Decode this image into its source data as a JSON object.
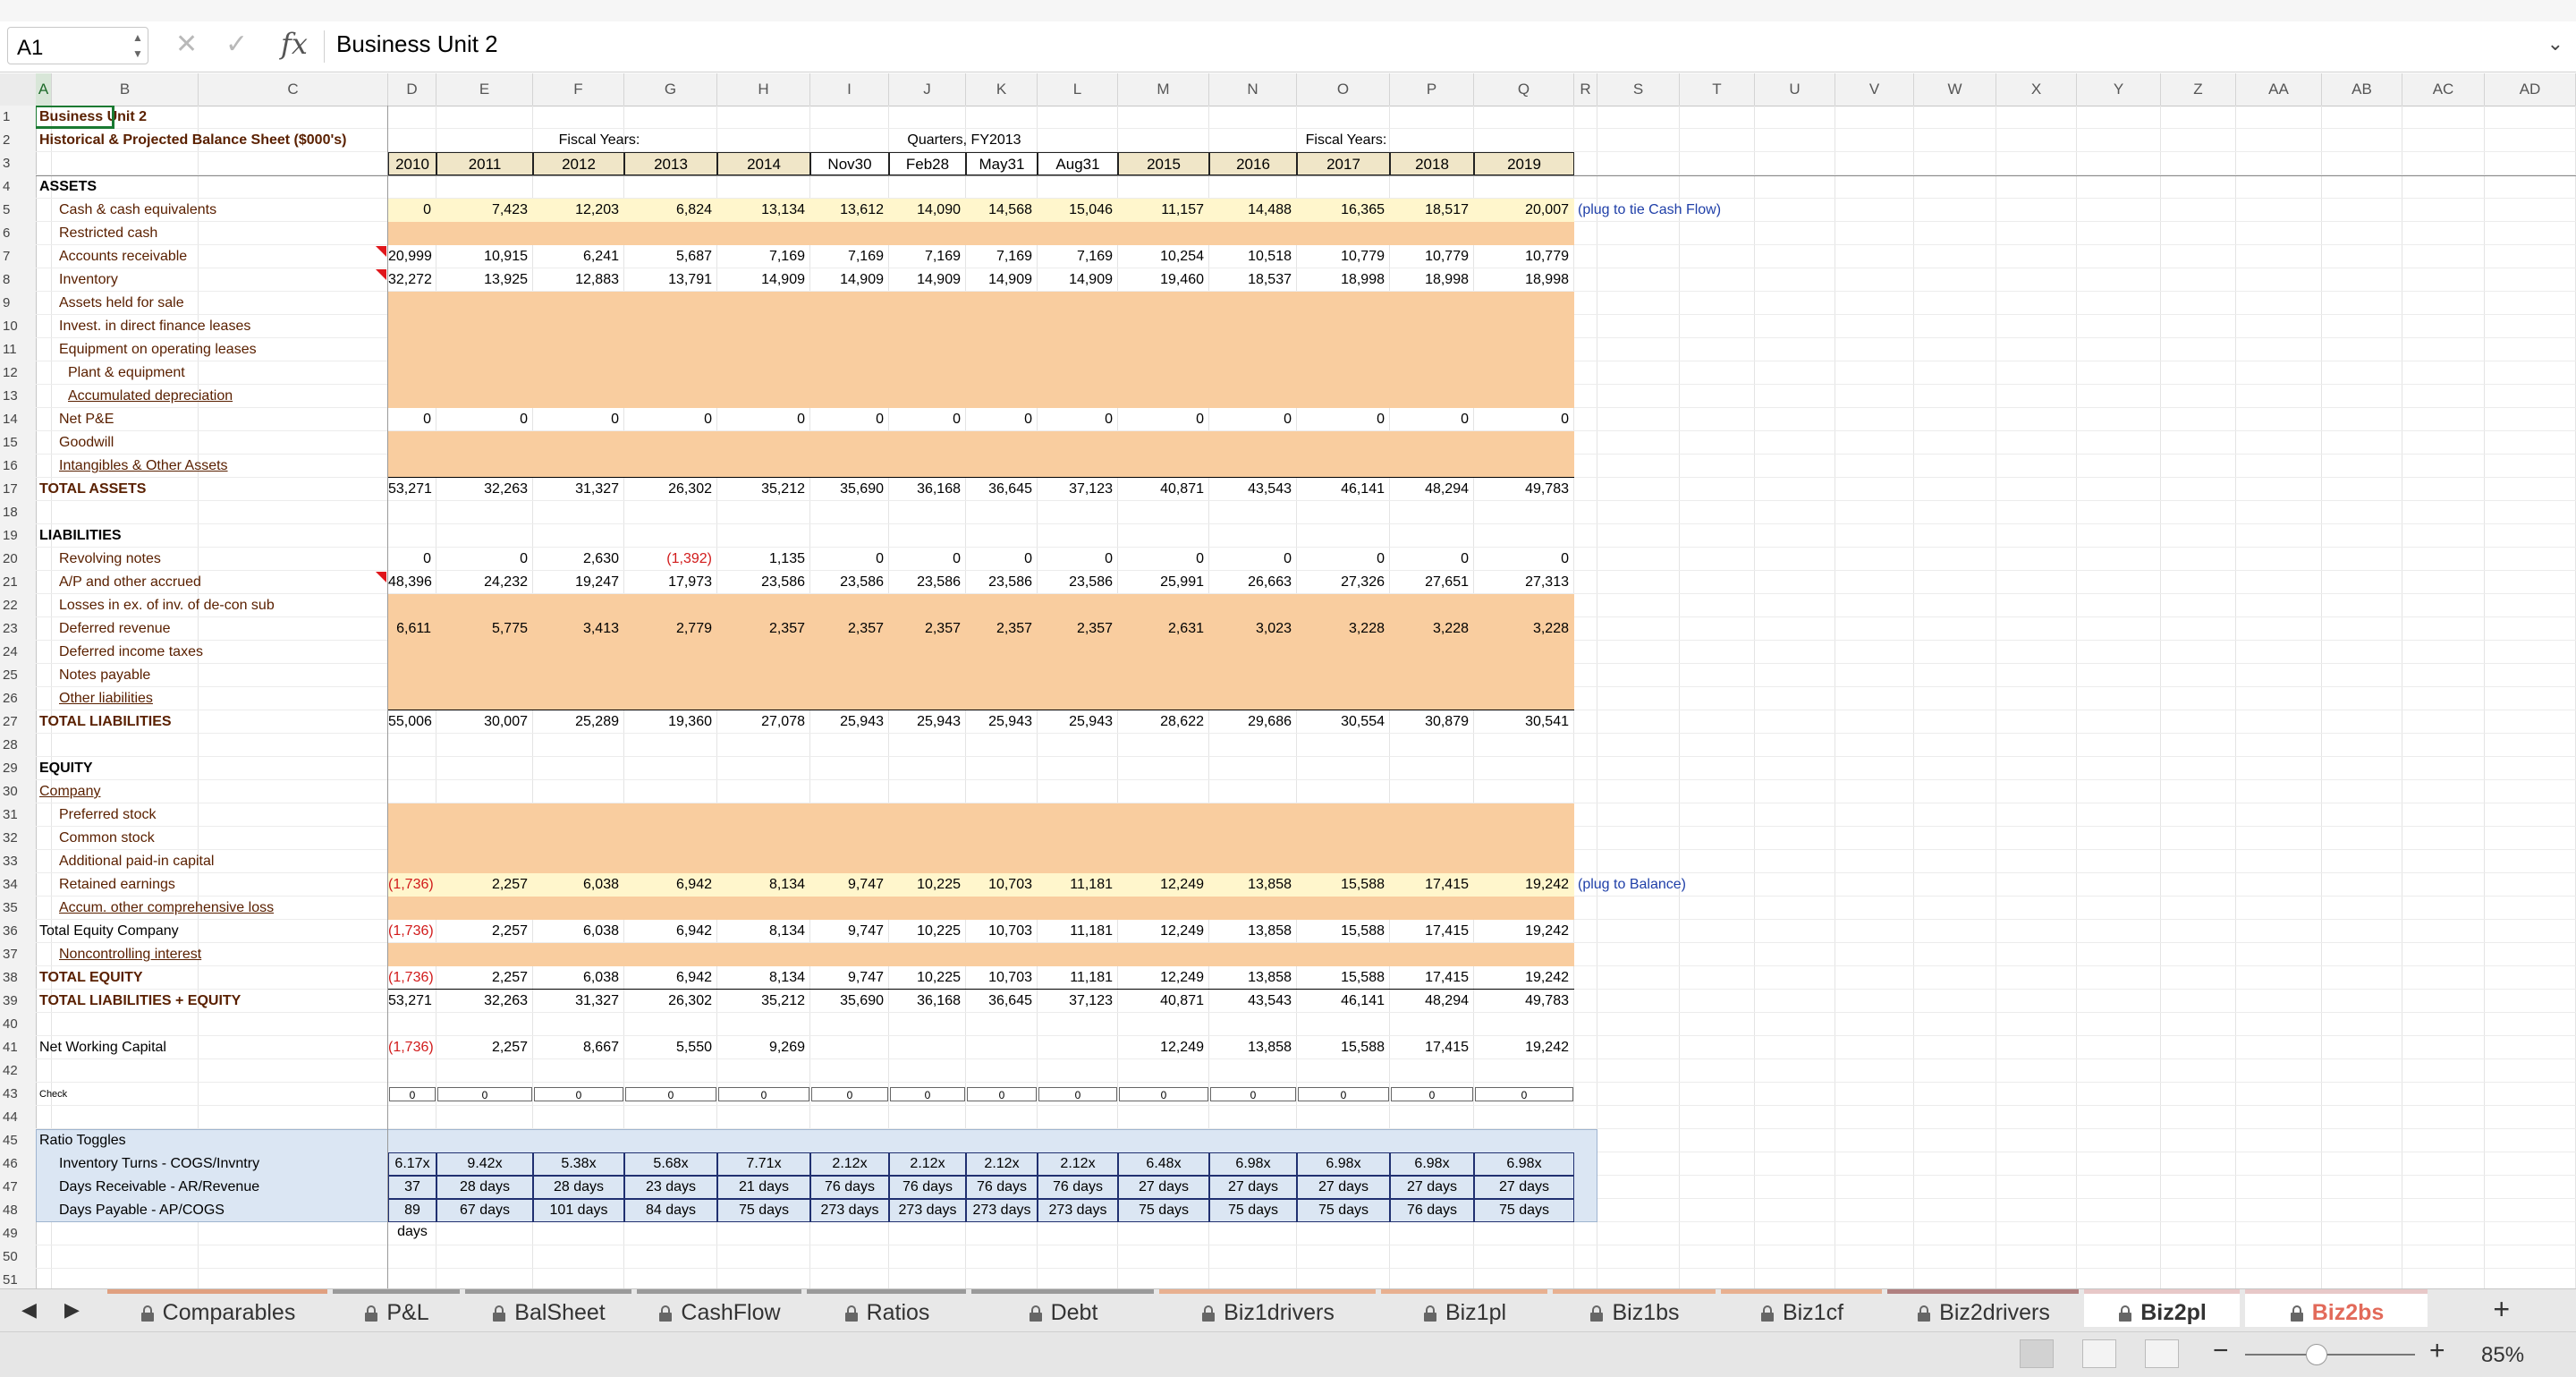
{
  "formula_bar": {
    "name_box": "A1",
    "cancel_icon": "✕",
    "enter_icon": "✓",
    "fx_label": "fx",
    "content": "Business Unit 2"
  },
  "columns": [
    "A",
    "B",
    "C",
    "D",
    "E",
    "F",
    "G",
    "H",
    "I",
    "J",
    "K",
    "L",
    "M",
    "N",
    "O",
    "P",
    "Q",
    "R",
    "S",
    "T",
    "U",
    "V",
    "W",
    "X",
    "Y",
    "Z",
    "AA",
    "AB",
    "AC",
    "AD"
  ],
  "sheet": {
    "title_a1": "Business Unit 2",
    "subtitle": "Historical & Projected Balance Sheet ($000's)",
    "fiscal_years_label": "Fiscal Years:",
    "quarters_label": "Quarters, FY2013",
    "fiscal_years_label2": "Fiscal Years:",
    "periods": [
      "2010",
      "2011",
      "2012",
      "2013",
      "2014",
      "Nov30",
      "Feb28",
      "May31",
      "Aug31",
      "2015",
      "2016",
      "2017",
      "2018",
      "2019"
    ],
    "notes": {
      "cash": "(plug to tie Cash Flow)",
      "retained": "(plug to Balance)"
    },
    "rows": [
      {
        "r": 4,
        "label": "ASSETS",
        "style": "section"
      },
      {
        "r": 5,
        "label": "Cash & cash equivalents",
        "values": [
          "0",
          "7,423",
          "12,203",
          "6,824",
          "13,134",
          "13,612",
          "14,090",
          "14,568",
          "15,046",
          "11,157",
          "14,488",
          "16,365",
          "18,517",
          "20,007"
        ]
      },
      {
        "r": 6,
        "label": "Restricted cash"
      },
      {
        "r": 7,
        "label": "Accounts receivable",
        "values": [
          "20,999",
          "10,915",
          "6,241",
          "5,687",
          "7,169",
          "7,169",
          "7,169",
          "7,169",
          "7,169",
          "10,254",
          "10,518",
          "10,779",
          "10,779",
          "10,779"
        ]
      },
      {
        "r": 8,
        "label": "Inventory",
        "values": [
          "32,272",
          "13,925",
          "12,883",
          "13,791",
          "14,909",
          "14,909",
          "14,909",
          "14,909",
          "14,909",
          "19,460",
          "18,537",
          "18,998",
          "18,998",
          "18,998"
        ]
      },
      {
        "r": 9,
        "label": "Assets held for sale"
      },
      {
        "r": 10,
        "label": "Invest. in direct finance leases"
      },
      {
        "r": 11,
        "label": "Equipment on operating leases"
      },
      {
        "r": 12,
        "label": "Plant & equipment",
        "indent2": true
      },
      {
        "r": 13,
        "label": "Accumulated depreciation",
        "indent2": true,
        "underline": true
      },
      {
        "r": 14,
        "label": "Net P&E",
        "values": [
          "0",
          "0",
          "0",
          "0",
          "0",
          "0",
          "0",
          "0",
          "0",
          "0",
          "0",
          "0",
          "0",
          "0"
        ]
      },
      {
        "r": 15,
        "label": "Goodwill"
      },
      {
        "r": 16,
        "label": "Intangibles & Other Assets",
        "underline": true
      },
      {
        "r": 17,
        "label": "TOTAL ASSETS",
        "style": "total",
        "values": [
          "53,271",
          "32,263",
          "31,327",
          "26,302",
          "35,212",
          "35,690",
          "36,168",
          "36,645",
          "37,123",
          "40,871",
          "43,543",
          "46,141",
          "48,294",
          "49,783"
        ]
      },
      {
        "r": 19,
        "label": "LIABILITIES",
        "style": "section"
      },
      {
        "r": 20,
        "label": "Revolving notes",
        "values": [
          "0",
          "0",
          "2,630",
          "(1,392)",
          "1,135",
          "0",
          "0",
          "0",
          "0",
          "0",
          "0",
          "0",
          "0",
          "0"
        ]
      },
      {
        "r": 21,
        "label": "A/P and other accrued",
        "values": [
          "48,396",
          "24,232",
          "19,247",
          "17,973",
          "23,586",
          "23,586",
          "23,586",
          "23,586",
          "23,586",
          "25,991",
          "26,663",
          "27,326",
          "27,651",
          "27,313"
        ]
      },
      {
        "r": 22,
        "label": "Losses in ex. of inv. of de-con sub"
      },
      {
        "r": 23,
        "label": "Deferred revenue",
        "values": [
          "6,611",
          "5,775",
          "3,413",
          "2,779",
          "2,357",
          "2,357",
          "2,357",
          "2,357",
          "2,357",
          "2,631",
          "3,023",
          "3,228",
          "3,228",
          "3,228"
        ]
      },
      {
        "r": 24,
        "label": "Deferred income taxes"
      },
      {
        "r": 25,
        "label": "Notes payable"
      },
      {
        "r": 26,
        "label": "Other liabilities",
        "underline": true
      },
      {
        "r": 27,
        "label": "TOTAL LIABILITIES",
        "style": "total",
        "values": [
          "55,006",
          "30,007",
          "25,289",
          "19,360",
          "27,078",
          "25,943",
          "25,943",
          "25,943",
          "25,943",
          "28,622",
          "29,686",
          "30,554",
          "30,879",
          "30,541"
        ]
      },
      {
        "r": 29,
        "label": "EQUITY",
        "style": "section"
      },
      {
        "r": 30,
        "label": "Company",
        "style": "sub"
      },
      {
        "r": 31,
        "label": "Preferred stock"
      },
      {
        "r": 32,
        "label": "Common stock"
      },
      {
        "r": 33,
        "label": "Additional paid-in capital"
      },
      {
        "r": 34,
        "label": "Retained earnings",
        "values": [
          "(1,736)",
          "2,257",
          "6,038",
          "6,942",
          "8,134",
          "9,747",
          "10,225",
          "10,703",
          "11,181",
          "12,249",
          "13,858",
          "15,588",
          "17,415",
          "19,242"
        ]
      },
      {
        "r": 35,
        "label": "Accum. other comprehensive loss",
        "underline": true
      },
      {
        "r": 36,
        "label": "Total Equity Company",
        "style": "plainA",
        "values": [
          "(1,736)",
          "2,257",
          "6,038",
          "6,942",
          "8,134",
          "9,747",
          "10,225",
          "10,703",
          "11,181",
          "12,249",
          "13,858",
          "15,588",
          "17,415",
          "19,242"
        ]
      },
      {
        "r": 37,
        "label": "Noncontrolling interest",
        "underline": true
      },
      {
        "r": 38,
        "label": "TOTAL EQUITY",
        "style": "total",
        "values": [
          "(1,736)",
          "2,257",
          "6,038",
          "6,942",
          "8,134",
          "9,747",
          "10,225",
          "10,703",
          "11,181",
          "12,249",
          "13,858",
          "15,588",
          "17,415",
          "19,242"
        ]
      },
      {
        "r": 39,
        "label": "TOTAL LIABILITIES + EQUITY",
        "style": "total",
        "values": [
          "53,271",
          "32,263",
          "31,327",
          "26,302",
          "35,212",
          "35,690",
          "36,168",
          "36,645",
          "37,123",
          "40,871",
          "43,543",
          "46,141",
          "48,294",
          "49,783"
        ]
      },
      {
        "r": 41,
        "label": "Net Working Capital",
        "style": "plainA",
        "values": [
          "(1,736)",
          "2,257",
          "8,667",
          "5,550",
          "9,269",
          "",
          "",
          "",
          "",
          "12,249",
          "13,858",
          "15,588",
          "17,415",
          "19,242"
        ]
      },
      {
        "r": 43,
        "label": "Check",
        "style": "check",
        "values": [
          "0",
          "0",
          "0",
          "0",
          "0",
          "0",
          "0",
          "0",
          "0",
          "0",
          "0",
          "0",
          "0",
          "0"
        ]
      }
    ],
    "ratio_title": "Ratio Toggles",
    "ratios": [
      {
        "r": 46,
        "label": "Inventory Turns - COGS/Invntry",
        "values": [
          "6.17x",
          "9.42x",
          "5.38x",
          "5.68x",
          "7.71x",
          "2.12x",
          "2.12x",
          "2.12x",
          "2.12x",
          "6.48x",
          "6.98x",
          "6.98x",
          "6.98x",
          "6.98x"
        ]
      },
      {
        "r": 47,
        "label": "Days Receivable - AR/Revenue",
        "values": [
          "37 days",
          "28 days",
          "28 days",
          "23 days",
          "21 days",
          "76 days",
          "76 days",
          "76 days",
          "76 days",
          "27 days",
          "27 days",
          "27 days",
          "27 days",
          "27 days"
        ]
      },
      {
        "r": 48,
        "label": "Days Payable - AP/COGS",
        "values": [
          "89 days",
          "67 days",
          "101 days",
          "84 days",
          "75 days",
          "273 days",
          "273 days",
          "273 days",
          "273 days",
          "75 days",
          "75 days",
          "75 days",
          "76 days",
          "75 days"
        ]
      }
    ]
  },
  "tabs": [
    {
      "label": "Comparables",
      "lock": true,
      "color": "#e0a080"
    },
    {
      "label": "P&L",
      "lock": true,
      "color": "#9a9a9a"
    },
    {
      "label": "BalSheet",
      "lock": true,
      "color": "#9a9a9a"
    },
    {
      "label": "CashFlow",
      "lock": true,
      "color": "#9a9a9a"
    },
    {
      "label": "Ratios",
      "lock": true,
      "color": "#9a9a9a"
    },
    {
      "label": "Debt",
      "lock": true,
      "color": "#9a9a9a"
    },
    {
      "label": "Biz1drivers",
      "lock": true,
      "color": "#e8b090"
    },
    {
      "label": "Biz1pl",
      "lock": true,
      "color": "#e8b090"
    },
    {
      "label": "Biz1bs",
      "lock": true,
      "color": "#e8b090"
    },
    {
      "label": "Biz1cf",
      "lock": true,
      "color": "#e8b090"
    },
    {
      "label": "Biz2drivers",
      "lock": true,
      "color": "#b08080"
    },
    {
      "label": "Biz2pl",
      "lock": true,
      "color": "#e8c8c8",
      "active": true
    },
    {
      "label": "Biz2bs",
      "lock": true,
      "color": "#e8c8c8",
      "active2": true
    }
  ],
  "tab_nav": {
    "prev": "◀",
    "next": "▶",
    "add": "+"
  },
  "status": {
    "zoom": "85%",
    "minus": "−",
    "plus": "+"
  },
  "colors": {
    "orange_fill": "#f9cd9f",
    "yellow_fill": "#fff6cc",
    "ratio_fill": "#dbe6f3",
    "negative": "#d11a1a",
    "note_blue": "#1f3fa8"
  }
}
